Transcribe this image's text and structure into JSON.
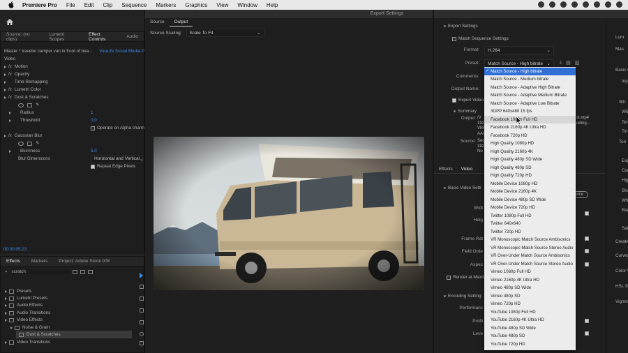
{
  "menubar": {
    "items": [
      "Premiere Pro",
      "File",
      "Edit",
      "Clip",
      "Sequence",
      "Markers",
      "Graphics",
      "View",
      "Window",
      "Help"
    ]
  },
  "left_top": {
    "tabs": [
      "Source: (no clips)",
      "Lumetri Scopes",
      "Effect Controls",
      "Audio"
    ],
    "master_label": "Master * traveler camper van in front of bea...",
    "sequence_label": "VanLife Social Media Post",
    "video_section": "Video",
    "effects": [
      {
        "label": "Motion"
      },
      {
        "label": "Opacity"
      },
      {
        "label": "Time Remapping"
      },
      {
        "label": "Lumetri Color"
      },
      {
        "label": "Dust & Scratches"
      }
    ],
    "dust": {
      "radius_label": "Radius",
      "radius_value": "1",
      "threshold_label": "Threshold",
      "threshold_value": "0.0",
      "alpha_label": "Operate on Alpha channel"
    },
    "gaussian_label": "Gaussian Blur",
    "blur": {
      "blurriness_label": "Blurriness",
      "blurriness_value": "5.0",
      "dimensions_label": "Blur Dimensions",
      "dimensions_value": "Horizontal and Vertical",
      "repeat_label": "Repeat Edge Pixels"
    },
    "timecode": "00:00:05:23"
  },
  "left_bottom": {
    "tabs": [
      "Effects",
      "Markers",
      "Project: Adobe Stock 008"
    ],
    "search_value": "scratch",
    "tree": [
      {
        "label": "Presets"
      },
      {
        "label": "Lumetri Presets"
      },
      {
        "label": "Audio Effects"
      },
      {
        "label": "Audio Transitions"
      },
      {
        "label": "Video Effects"
      },
      {
        "label": "Noise & Grain"
      },
      {
        "label": "Dust & Scratches"
      },
      {
        "label": "Video Transitions"
      }
    ]
  },
  "dialog": {
    "title": "Export Settings",
    "tabs": [
      "Source",
      "Output"
    ],
    "scaling_label": "Source Scaling:",
    "scaling_value": "Scale To Fit"
  },
  "settings": {
    "section_title": "Export Settings",
    "match_seq": "Match Sequence Settings",
    "format_label": "Format:",
    "format_value": "H.264",
    "preset_label": "Preset:",
    "preset_value": "Match Source - High bitrate",
    "comments_label": "Comments:",
    "output_label": "Output Name:",
    "export_video": "Export Video",
    "summary_label": "Summary",
    "output_summary_label": "Output:",
    "output_summary_lines": [
      "/V",
      "192",
      "VBR",
      "AAC"
    ],
    "output_summary_tail": [
      "st.mp4",
      "oding..."
    ],
    "source_summary_label": "Source:",
    "source_summary_lines": [
      "Seq",
      "192",
      "No"
    ],
    "tabs": [
      "Effects",
      "Video"
    ],
    "basic_video": "Basic Video Setti",
    "labels": [
      "Widt",
      "Heig",
      "Frame Rat",
      "Field Orde",
      "Aspec"
    ],
    "match_source_btn": "ource",
    "render_max": "Render at Maxim",
    "encoding": "Encoding Setting",
    "perf_labels": [
      "Performanc",
      "Profil",
      "Leve"
    ]
  },
  "far_right": {
    "labels": [
      "Lum",
      "Mas",
      "Basic Co",
      "Inpu",
      "Wh",
      "WB",
      "Tem",
      "Tint",
      "Ton",
      "Exp",
      "Con",
      "High",
      "Sha",
      "Whi",
      "Blac",
      "Satu",
      "Creativ",
      "Curves",
      "Color W",
      "HSL Se",
      "Vignett"
    ]
  },
  "dropdown": {
    "items": [
      "Match Source - High bitrate",
      "Match Source - Medium bitrate",
      "Match Source - Adaptive High Bitrate",
      "Match Source - Adaptive Medium Bitrate",
      "Match Source - Adaptive Low Bitrate",
      "3GPP 640x480 15 fps",
      "Facebook 1080p Full HD",
      "Facebook 2160p 4K Ultra HD",
      "Facebook 720p HD",
      "High Quality 1080p HD",
      "High Quality 2160p 4K",
      "High Quality 480p SD Wide",
      "High Quality 480p SD",
      "High Quality 720p HD",
      "Mobile Device 1080p HD",
      "Mobile Device 2160p 4K",
      "Mobile Device 480p SD Wide",
      "Mobile Device 720p HD",
      "Twitter 1080p Full HD",
      "Twitter 640x640",
      "Twitter 720p HD",
      "VR Monoscopic Match Source Ambisonics",
      "VR Monoscopic Match Source Stereo Audio",
      "VR Over-Under Match Source Ambisonics",
      "VR Over-Under Match Source Stereo Audio",
      "Vimeo 1080p Full HD",
      "Vimeo 2160p 4K Ultra HD",
      "Vimeo 480p SD Wide",
      "Vimeo 480p SD",
      "Vimeo 720p HD",
      "YouTube 1080p Full HD",
      "YouTube 2160p 4K Ultra HD",
      "YouTube 480p SD Wide",
      "YouTube 480p SD",
      "YouTube 720p HD"
    ],
    "selected_index": 0,
    "hover_index": 6
  },
  "colors": {
    "accent": "#3d8ae6",
    "selection": "#2f6fd6",
    "menu_bg": "#ececec"
  }
}
